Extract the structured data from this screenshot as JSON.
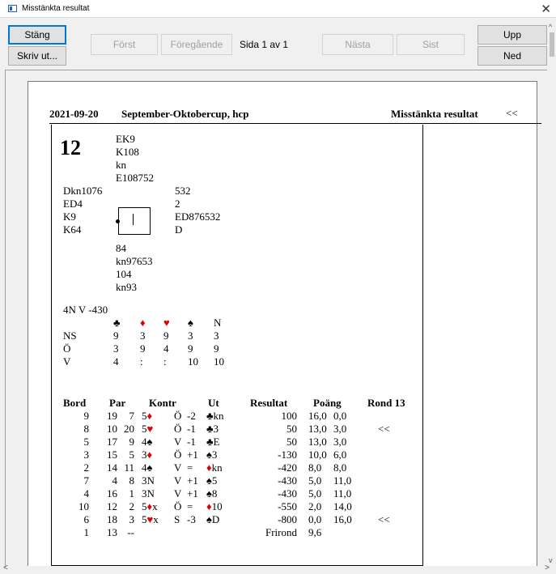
{
  "window": {
    "title": "Misstänkta resultat",
    "close_glyph": "✕"
  },
  "toolbar": {
    "close_label": "Stäng",
    "print_label": "Skriv ut...",
    "first_label": "Först",
    "prev_label": "Föregående",
    "page_label": "Sida 1 av 1",
    "next_label": "Nästa",
    "last_label": "Sist",
    "up_label": "Upp",
    "down_label": "Ned"
  },
  "scroll": {
    "up_glyph": "^",
    "down_glyph": "v",
    "left_glyph": "<",
    "right_glyph": ">"
  },
  "report": {
    "date": "2021-09-20",
    "event": "September-Oktobercup, hcp",
    "report_title": "Misstänkta resultat",
    "nav_marker": "<<"
  },
  "board": {
    "number": "12",
    "north": [
      "EK9",
      "K108",
      "kn",
      "E108752"
    ],
    "west": [
      "Dkn1076",
      "ED4",
      "K9",
      "K64"
    ],
    "east": [
      "532",
      "2",
      "ED876532",
      "D"
    ],
    "south": [
      "84",
      "kn97653",
      "104",
      "kn93"
    ],
    "par": "4N V -430",
    "dd_suits": [
      "♣",
      "♦",
      "♥",
      "♠",
      "N"
    ],
    "dd_rows": [
      {
        "side": "NS",
        "values": [
          "9",
          "3",
          "9",
          "3",
          "3"
        ]
      },
      {
        "side": "Ö",
        "values": [
          "3",
          "9",
          "4",
          "9",
          "9"
        ]
      },
      {
        "side": "V",
        "values": [
          "4",
          ":",
          ":",
          "10",
          "10"
        ]
      }
    ]
  },
  "results": {
    "headers": {
      "table": "Bord",
      "pair": "Par",
      "contract": "Kontr",
      "lead": "Ut",
      "result": "Resultat",
      "points": "Poäng",
      "round": "Rond 13"
    },
    "rows": [
      {
        "table": "9",
        "ns": "19",
        "ew": "7",
        "contract": "5♦",
        "decl": "Ö",
        "tricks": "-2",
        "lead": "♣kn",
        "result": "100",
        "p1": "16,0",
        "p2": "0,0",
        "flag": ""
      },
      {
        "table": "8",
        "ns": "10",
        "ew": "20",
        "contract": "5♥",
        "decl": "Ö",
        "tricks": "-1",
        "lead": "♣3",
        "result": "50",
        "p1": "13,0",
        "p2": "3,0",
        "flag": "<<"
      },
      {
        "table": "5",
        "ns": "17",
        "ew": "9",
        "contract": "4♠",
        "decl": "V",
        "tricks": "-1",
        "lead": "♣E",
        "result": "50",
        "p1": "13,0",
        "p2": "3,0",
        "flag": ""
      },
      {
        "table": "3",
        "ns": "15",
        "ew": "5",
        "contract": "3♦",
        "decl": "Ö",
        "tricks": "+1",
        "lead": "♠3",
        "result": "-130",
        "p1": "10,0",
        "p2": "6,0",
        "flag": ""
      },
      {
        "table": "2",
        "ns": "14",
        "ew": "11",
        "contract": "4♠",
        "decl": "V",
        "tricks": "=",
        "lead": "♦kn",
        "result": "-420",
        "p1": "8,0",
        "p2": "8,0",
        "flag": ""
      },
      {
        "table": "7",
        "ns": "4",
        "ew": "8",
        "contract": "3N",
        "decl": "V",
        "tricks": "+1",
        "lead": "♠5",
        "result": "-430",
        "p1": "5,0",
        "p2": "11,0",
        "flag": ""
      },
      {
        "table": "4",
        "ns": "16",
        "ew": "1",
        "contract": "3N",
        "decl": "V",
        "tricks": "+1",
        "lead": "♠8",
        "result": "-430",
        "p1": "5,0",
        "p2": "11,0",
        "flag": ""
      },
      {
        "table": "10",
        "ns": "12",
        "ew": "2",
        "contract": "5♦x",
        "decl": "Ö",
        "tricks": "=",
        "lead": "♦10",
        "result": "-550",
        "p1": "2,0",
        "p2": "14,0",
        "flag": ""
      },
      {
        "table": "6",
        "ns": "18",
        "ew": "3",
        "contract": "5♥x",
        "decl": "S",
        "tricks": "-3",
        "lead": "♠D",
        "result": "-800",
        "p1": "0,0",
        "p2": "16,0",
        "flag": "<<"
      },
      {
        "table": "1",
        "ns": "13",
        "ew": "--",
        "contract": "",
        "decl": "",
        "tricks": "",
        "lead": "",
        "result": "Frirond",
        "p1": "9,6",
        "p2": "",
        "flag": ""
      }
    ]
  }
}
